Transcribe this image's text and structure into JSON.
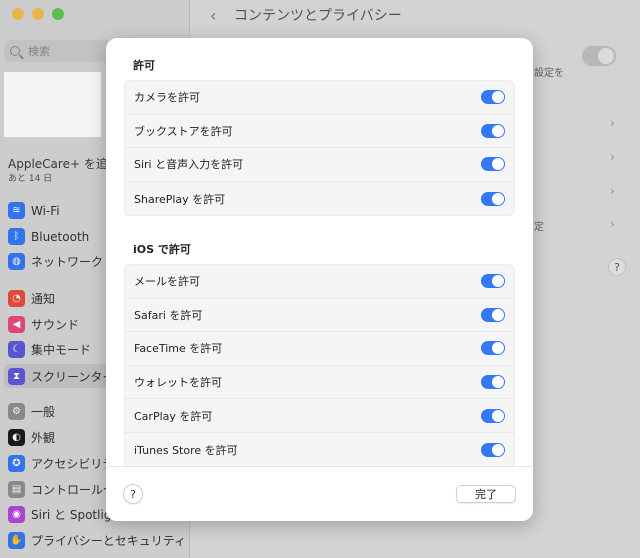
{
  "window": {
    "title": "コンテンツとプライバシー",
    "traffic_colors": [
      "#f4bd4f",
      "#f4bd4f",
      "#61c554"
    ]
  },
  "sidebar": {
    "search_placeholder": "検索",
    "applecare": "AppleCare+ を追加",
    "applecare_sub": "あと 14 日",
    "items": [
      {
        "label": "Wi-Fi",
        "icon": "wifi-icon",
        "color": "#3478f6",
        "glyph": "≋"
      },
      {
        "label": "Bluetooth",
        "icon": "bluetooth-icon",
        "color": "#3478f6",
        "glyph": "ᛒ"
      },
      {
        "label": "ネットワーク",
        "icon": "globe-icon",
        "color": "#3478f6",
        "glyph": "◍"
      },
      {
        "label": "通知",
        "icon": "bell-icon",
        "color": "#ea4c3c",
        "glyph": "◔"
      },
      {
        "label": "サウンド",
        "icon": "speaker-icon",
        "color": "#e8497a",
        "glyph": "◀"
      },
      {
        "label": "集中モード",
        "icon": "moon-icon",
        "color": "#5d5ad6",
        "glyph": "☾"
      },
      {
        "label": "スクリーンタイム",
        "icon": "hourglass-icon",
        "color": "#5d5ad6",
        "glyph": "⧗"
      },
      {
        "label": "一般",
        "icon": "gear-icon",
        "color": "#8e8e93",
        "glyph": "⚙"
      },
      {
        "label": "外観",
        "icon": "appearance-icon",
        "color": "#1c1c1e",
        "glyph": "◐"
      },
      {
        "label": "アクセシビリティ",
        "icon": "accessibility-icon",
        "color": "#3478f6",
        "glyph": "✪"
      },
      {
        "label": "コントロールセンター",
        "icon": "control-center-icon",
        "color": "#8e8e93",
        "glyph": "▤"
      },
      {
        "label": "Siri と Spotlight",
        "icon": "siri-icon",
        "color": "#b347d6",
        "glyph": "◉"
      },
      {
        "label": "プライバシーとセキュリティ",
        "icon": "hand-icon",
        "color": "#3478f6",
        "glyph": "✋"
      }
    ]
  },
  "background": {
    "toggle_text": "設定を",
    "text2": "定"
  },
  "sheet": {
    "sections": [
      {
        "title": "許可",
        "rows": [
          {
            "label": "カメラを許可",
            "on": true
          },
          {
            "label": "ブックストアを許可",
            "on": true
          },
          {
            "label": "Siri と音声入力を許可",
            "on": true
          },
          {
            "label": "SharePlay を許可",
            "on": true
          }
        ]
      },
      {
        "title": "iOS で許可",
        "rows": [
          {
            "label": "メールを許可",
            "on": true
          },
          {
            "label": "Safari を許可",
            "on": true
          },
          {
            "label": "FaceTime を許可",
            "on": true
          },
          {
            "label": "ウォレットを許可",
            "on": true
          },
          {
            "label": "CarPlay を許可",
            "on": true
          },
          {
            "label": "iTunes Store を許可",
            "on": true
          }
        ]
      }
    ],
    "help_label": "?",
    "done_label": "完了",
    "accent": "#3478f6"
  }
}
